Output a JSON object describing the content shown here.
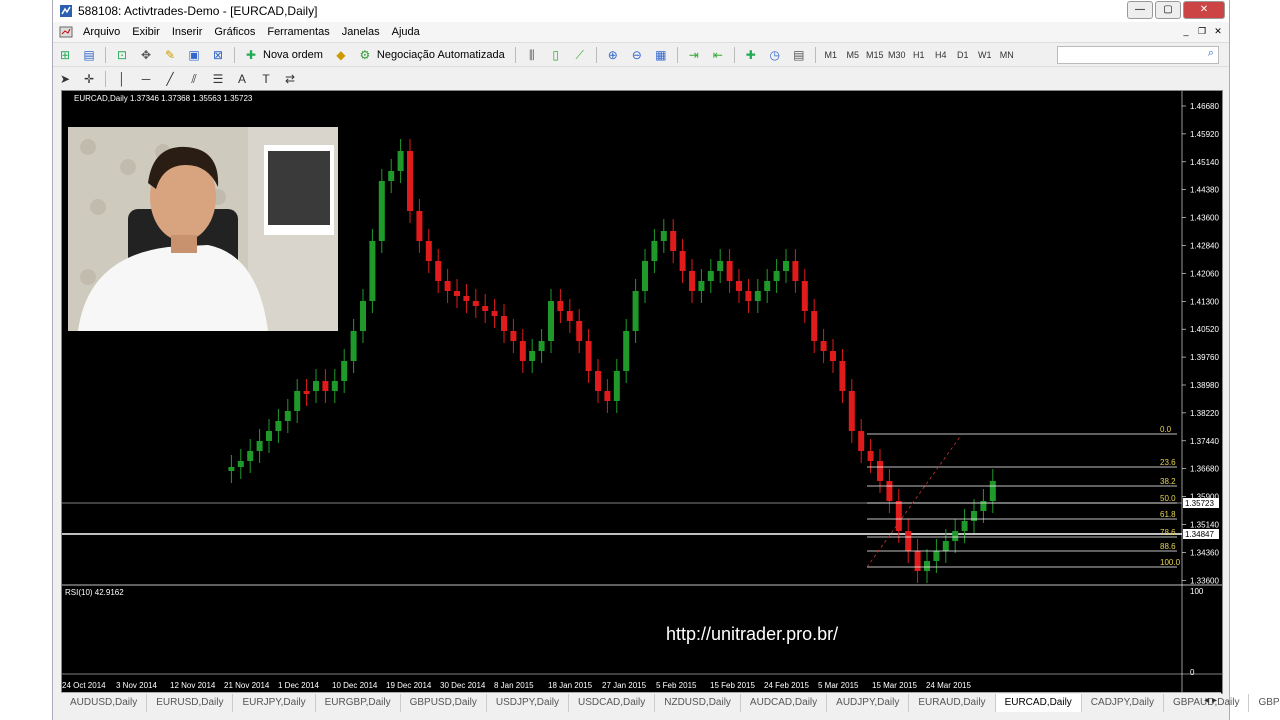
{
  "window": {
    "title": "588108: Activtrades-Demo - [EURCAD,Daily]"
  },
  "menu": [
    "Arquivo",
    "Exibir",
    "Inserir",
    "Gráficos",
    "Ferramentas",
    "Janelas",
    "Ajuda"
  ],
  "toolbar": {
    "new_order_label": "Nova ordem",
    "auto_trading_label": "Negociação Automatizada",
    "timeframes": [
      "M1",
      "M5",
      "M15",
      "M30",
      "H1",
      "H4",
      "D1",
      "W1",
      "MN"
    ]
  },
  "chart": {
    "header": "EURCAD,Daily  1.37346 1.37368 1.35563 1.35723",
    "price_ticks": [
      "1.46680",
      "1.45920",
      "1.45140",
      "1.44380",
      "1.43600",
      "1.42840",
      "1.42060",
      "1.41300",
      "1.40520",
      "1.39760",
      "1.38980",
      "1.38220",
      "1.37440",
      "1.36680",
      "1.35900",
      "1.35140",
      "1.34360",
      "1.33600"
    ],
    "current_price_label": "1.35723",
    "line_price_label": "1.34847",
    "fib_levels": [
      "0.0",
      "23.6",
      "38.2",
      "50.0",
      "61.8",
      "78.6",
      "88.6",
      "100.0"
    ],
    "rsi_label": "RSI(10) 42.9162",
    "rsi_max": "100",
    "rsi_min": "0",
    "watermark": "http://unitrader.pro.br/",
    "date_ticks": [
      "24 Oct 2014",
      "3 Nov 2014",
      "12 Nov 2014",
      "21 Nov 2014",
      "1 Dec 2014",
      "10 Dec 2014",
      "19 Dec 2014",
      "30 Dec 2014",
      "8 Jan 2015",
      "18 Jan 2015",
      "27 Jan 2015",
      "5 Feb 2015",
      "15 Feb 2015",
      "24 Feb 2015",
      "5 Mar 2015",
      "15 Mar 2015",
      "24 Mar 2015"
    ],
    "colors": {
      "bull": "#1f9a2a",
      "bear": "#e01b1b",
      "fib": "#ffffff",
      "fib_text": "#e8d44d"
    }
  },
  "tabs": [
    "AUDUSD,Daily",
    "EURUSD,Daily",
    "EURJPY,Daily",
    "EURGBP,Daily",
    "GBPUSD,Daily",
    "USDJPY,Daily",
    "USDCAD,Daily",
    "NZDUSD,Daily",
    "AUDCAD,Daily",
    "AUDJPY,Daily",
    "EURAUD,Daily",
    "EURCAD,Daily",
    "CADJPY,Daily",
    "GBPAUD,Daily",
    "GBPJPY,Daily"
  ],
  "active_tab": "EURCAD,Daily"
}
